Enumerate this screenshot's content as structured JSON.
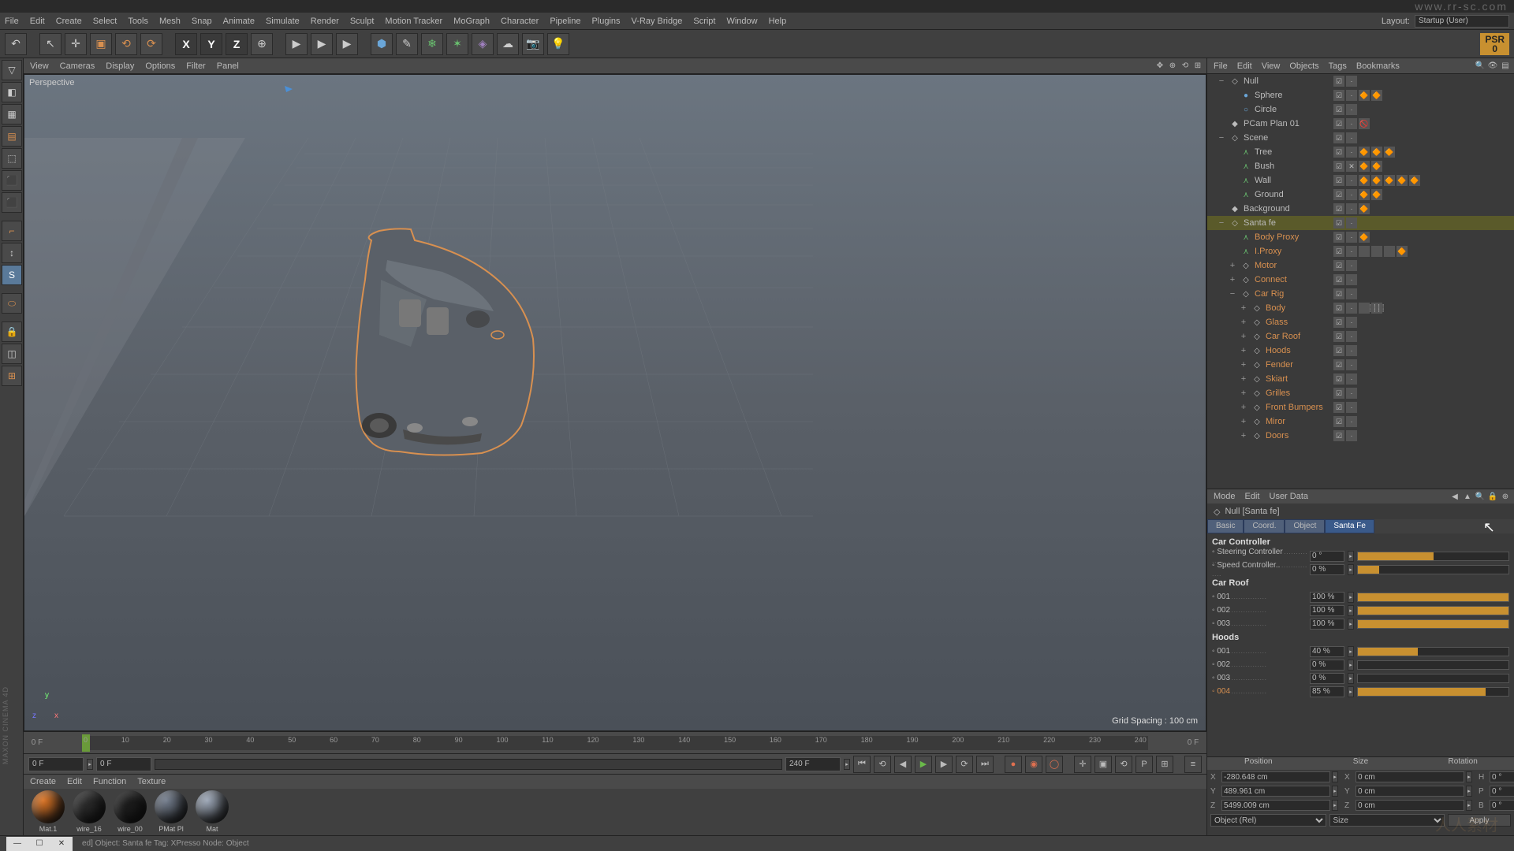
{
  "topbar": {
    "url": "www.rr-sc.com"
  },
  "menubar": {
    "items": [
      "File",
      "Edit",
      "Create",
      "Select",
      "Tools",
      "Mesh",
      "Snap",
      "Animate",
      "Simulate",
      "Render",
      "Sculpt",
      "Motion Tracker",
      "MoGraph",
      "Character",
      "Pipeline",
      "Plugins",
      "V-Ray Bridge",
      "Script",
      "Window",
      "Help"
    ],
    "layout_label": "Layout:",
    "layout_value": "Startup (User)"
  },
  "psr": {
    "label": "PSR",
    "value": "0"
  },
  "vp_menubar": {
    "items": [
      "View",
      "Cameras",
      "Display",
      "Options",
      "Filter",
      "Panel"
    ]
  },
  "viewport": {
    "label": "Perspective",
    "grid_info": "Grid Spacing : 100 cm"
  },
  "timeline": {
    "ticks": [
      "0",
      "10",
      "20",
      "30",
      "40",
      "50",
      "60",
      "70",
      "80",
      "90",
      "100",
      "110",
      "120",
      "130",
      "140",
      "150",
      "160",
      "170",
      "180",
      "190",
      "200",
      "210",
      "220",
      "230",
      "240"
    ],
    "start": "0 F",
    "end": "0 F"
  },
  "frame": {
    "left": "0 F",
    "left2": "0 F",
    "right": "240 F"
  },
  "materials": {
    "menu": [
      "Create",
      "Edit",
      "Function",
      "Texture"
    ],
    "items": [
      {
        "name": "Mat.1",
        "color": "#d87020"
      },
      {
        "name": "wire_16",
        "color": "#2a2a2a"
      },
      {
        "name": "wire_00",
        "color": "#1a1a1a"
      },
      {
        "name": "PMat Pl",
        "color": "#707a8a"
      },
      {
        "name": "Mat",
        "color": "#9aa5b5"
      }
    ]
  },
  "obj_menu": {
    "items": [
      "File",
      "Edit",
      "View",
      "Objects",
      "Tags",
      "Bookmarks"
    ]
  },
  "tree": [
    {
      "d": 0,
      "exp": "−",
      "icon": "◇",
      "name": "Null",
      "tags": [
        "☑",
        "·"
      ]
    },
    {
      "d": 1,
      "exp": "",
      "icon": "●",
      "name": "Sphere",
      "tags": [
        "☑",
        "·",
        "🔶",
        "🔶"
      ],
      "iconColor": "#6aa6d8"
    },
    {
      "d": 1,
      "exp": "",
      "icon": "○",
      "name": "Circle",
      "tags": [
        "☑",
        "·"
      ],
      "iconColor": "#6aa6d8"
    },
    {
      "d": 0,
      "exp": "",
      "icon": "◆",
      "name": "PCam Plan 01",
      "tags": [
        "☑",
        "·",
        "🚫"
      ]
    },
    {
      "d": 0,
      "exp": "−",
      "icon": "◇",
      "name": "Scene",
      "tags": [
        "☑",
        "·"
      ]
    },
    {
      "d": 1,
      "exp": "",
      "icon": "⋏",
      "name": "Tree",
      "tags": [
        "☑",
        "·",
        "🔶",
        "🔶",
        "🔶"
      ],
      "iconColor": "#6ac270"
    },
    {
      "d": 1,
      "exp": "",
      "icon": "⋏",
      "name": "Bush",
      "tags": [
        "☑",
        "✕",
        "🔶",
        "🔶"
      ],
      "iconColor": "#6ac270"
    },
    {
      "d": 1,
      "exp": "",
      "icon": "⋏",
      "name": "Wall",
      "tags": [
        "☑",
        "·",
        "🔶",
        "🔶",
        "🔶",
        "🔶",
        "🔶"
      ],
      "iconColor": "#6ac270"
    },
    {
      "d": 1,
      "exp": "",
      "icon": "⋏",
      "name": "Ground",
      "tags": [
        "☑",
        "·",
        "🔶",
        "🔶"
      ],
      "iconColor": "#6ac270"
    },
    {
      "d": 0,
      "exp": "",
      "icon": "◆",
      "name": "Background",
      "tags": [
        "☑",
        "·",
        "🔶"
      ]
    },
    {
      "d": 0,
      "exp": "−",
      "icon": "◇",
      "name": "Santa fe",
      "tags": [
        "☑",
        "·"
      ],
      "sel": true
    },
    {
      "d": 1,
      "exp": "",
      "icon": "⋏",
      "name": "Body Proxy",
      "orange": true,
      "tags": [
        "☑",
        "·",
        "🔶"
      ],
      "iconColor": "#6ac270"
    },
    {
      "d": 1,
      "exp": "",
      "icon": "⋏",
      "name": "I.Proxy",
      "orange": true,
      "tags": [
        "☑",
        "·",
        "",
        "",
        "",
        "🔶"
      ],
      "iconColor": "#6ac270"
    },
    {
      "d": 1,
      "exp": "+",
      "icon": "◇",
      "name": "Motor",
      "orange": true,
      "tags": [
        "☑",
        "·"
      ]
    },
    {
      "d": 1,
      "exp": "+",
      "icon": "◇",
      "name": "Connect",
      "orange": true,
      "tags": [
        "☑",
        "·"
      ]
    },
    {
      "d": 1,
      "exp": "−",
      "icon": "◇",
      "name": "Car Rig",
      "orange": true,
      "tags": [
        "☑",
        "·"
      ]
    },
    {
      "d": 2,
      "exp": "+",
      "icon": "◇",
      "name": "Body",
      "orange": true,
      "tags": [
        "☑",
        "·",
        "",
        "┊┊┊┊"
      ]
    },
    {
      "d": 2,
      "exp": "+",
      "icon": "◇",
      "name": "Glass",
      "orange": true,
      "tags": [
        "☑",
        "·"
      ]
    },
    {
      "d": 2,
      "exp": "+",
      "icon": "◇",
      "name": "Car Roof",
      "orange": true,
      "tags": [
        "☑",
        "·"
      ]
    },
    {
      "d": 2,
      "exp": "+",
      "icon": "◇",
      "name": "Hoods",
      "orange": true,
      "tags": [
        "☑",
        "·"
      ]
    },
    {
      "d": 2,
      "exp": "+",
      "icon": "◇",
      "name": "Fender",
      "orange": true,
      "tags": [
        "☑",
        "·"
      ]
    },
    {
      "d": 2,
      "exp": "+",
      "icon": "◇",
      "name": "Skiart",
      "orange": true,
      "tags": [
        "☑",
        "·"
      ]
    },
    {
      "d": 2,
      "exp": "+",
      "icon": "◇",
      "name": "Grilles",
      "orange": true,
      "tags": [
        "☑",
        "·"
      ]
    },
    {
      "d": 2,
      "exp": "+",
      "icon": "◇",
      "name": "Front Bumpers",
      "orange": true,
      "tags": [
        "☑",
        "·"
      ]
    },
    {
      "d": 2,
      "exp": "+",
      "icon": "◇",
      "name": "Miror",
      "orange": true,
      "tags": [
        "☑",
        "·"
      ]
    },
    {
      "d": 2,
      "exp": "+",
      "icon": "◇",
      "name": "Doors",
      "orange": true,
      "tags": [
        "☑",
        "·"
      ]
    }
  ],
  "attr": {
    "menu": [
      "Mode",
      "Edit",
      "User Data"
    ],
    "title": "Null [Santa fe]",
    "tabs": [
      "Basic",
      "Coord.",
      "Object",
      "Santa Fe"
    ],
    "sections": {
      "car_controller": {
        "label": "Car Controller",
        "rows": [
          {
            "label": "Steering Controller",
            "value": "0 °",
            "pct": 50
          },
          {
            "label": "Speed Controller..",
            "value": "0 %",
            "pct": 14
          }
        ]
      },
      "car_roof": {
        "label": "Car Roof",
        "rows": [
          {
            "label": "001",
            "value": "100 %",
            "pct": 100
          },
          {
            "label": "002",
            "value": "100 %",
            "pct": 100
          },
          {
            "label": "003",
            "value": "100 %",
            "pct": 100
          }
        ]
      },
      "hoods": {
        "label": "Hoods",
        "rows": [
          {
            "label": "001",
            "value": "40 %",
            "pct": 40
          },
          {
            "label": "002",
            "value": "0 %",
            "pct": 0
          },
          {
            "label": "003",
            "value": "0 %",
            "pct": 0
          },
          {
            "label": "004",
            "value": "85 %",
            "pct": 85,
            "orange": true
          }
        ]
      }
    }
  },
  "coord": {
    "heads": [
      "Position",
      "Size",
      "Rotation"
    ],
    "rows": [
      {
        "a": "X",
        "av": "-280.648 cm",
        "b": "X",
        "bv": "0 cm",
        "c": "H",
        "cv": "0 °"
      },
      {
        "a": "Y",
        "av": "489.961 cm",
        "b": "Y",
        "bv": "0 cm",
        "c": "P",
        "cv": "0 °"
      },
      {
        "a": "Z",
        "av": "5499.009 cm",
        "b": "Z",
        "bv": "0 cm",
        "c": "B",
        "cv": "0 °"
      }
    ],
    "sel1": "Object (Rel)",
    "sel2": "Size",
    "apply": "Apply"
  },
  "status": {
    "text": "ed] Object: Santa fe  Tag: XPresso  Node: Object"
  },
  "brand": "MAXON CINEMA 4D"
}
